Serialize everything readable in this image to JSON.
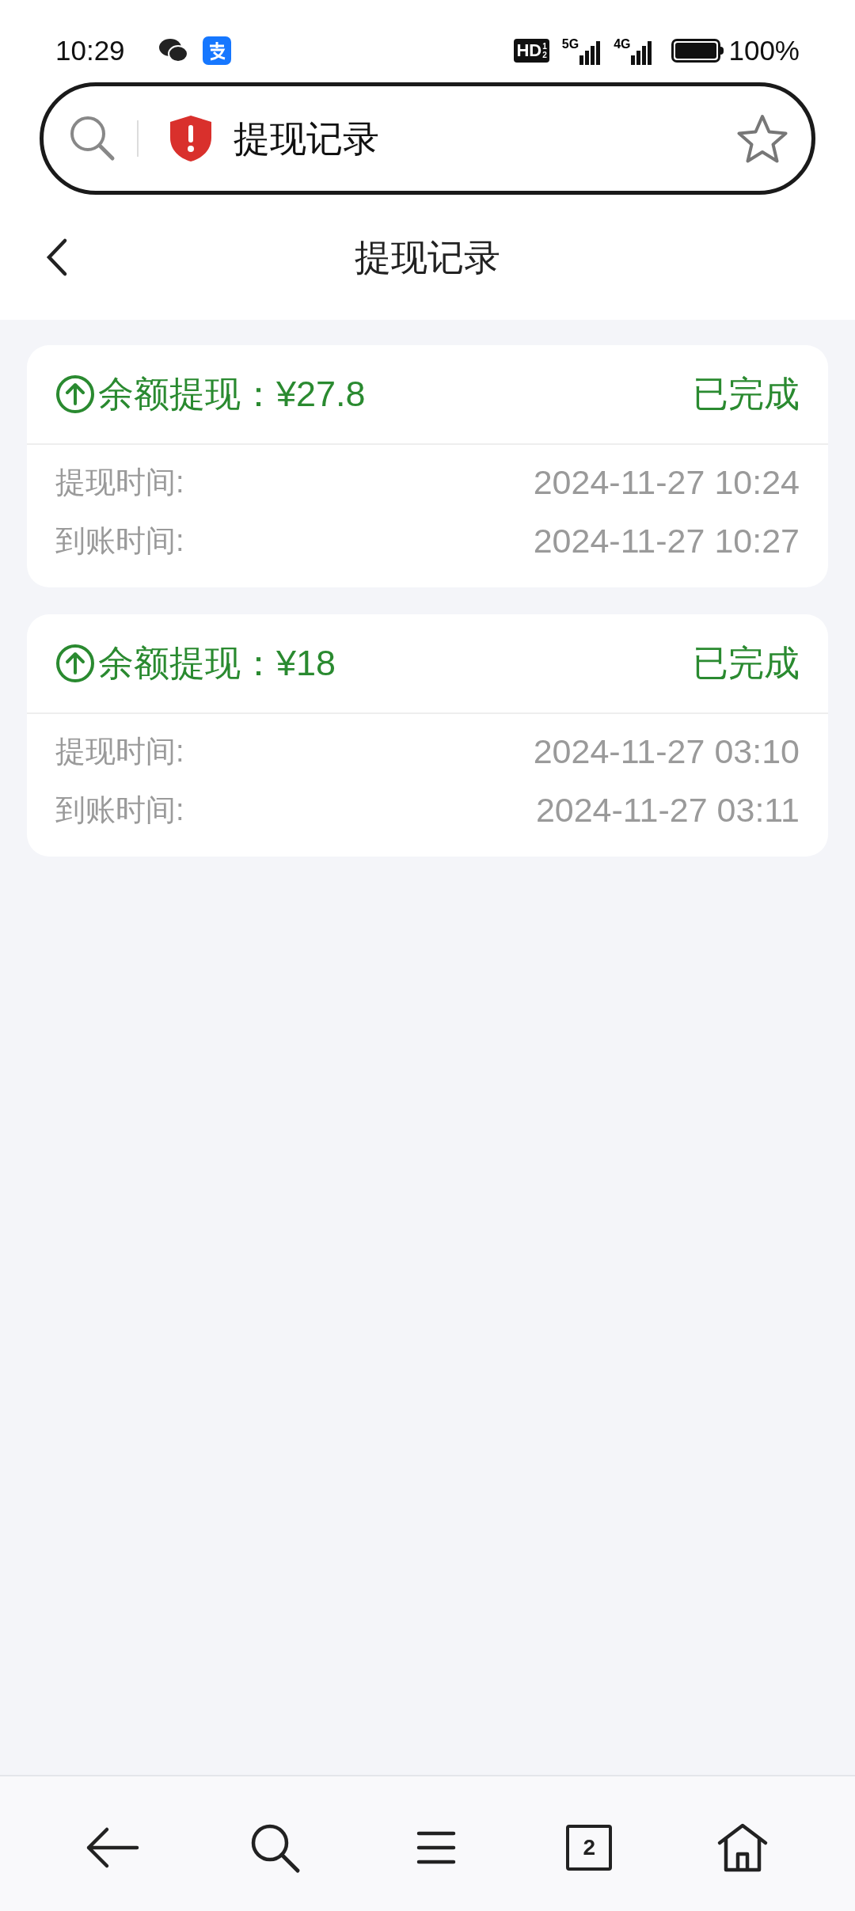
{
  "status_bar": {
    "time": "10:29",
    "hd": "HD",
    "hd_fraction": [
      "1",
      "2"
    ],
    "networks": [
      "5G",
      "4G"
    ],
    "battery": "100%"
  },
  "address_bar": {
    "title": "提现记录",
    "bookmarked": false
  },
  "header": {
    "title": "提现记录"
  },
  "records": [
    {
      "title": "余额提现：¥27.8",
      "status": "已完成",
      "rows": [
        {
          "label": "提现时间:",
          "value": "2024-11-27 10:24"
        },
        {
          "label": "到账时间:",
          "value": "2024-11-27 10:27"
        }
      ]
    },
    {
      "title": "余额提现：¥18",
      "status": "已完成",
      "rows": [
        {
          "label": "提现时间:",
          "value": "2024-11-27 03:10"
        },
        {
          "label": "到账时间:",
          "value": "2024-11-27 03:11"
        }
      ]
    }
  ],
  "bottom_nav": {
    "tab_count": "2"
  }
}
